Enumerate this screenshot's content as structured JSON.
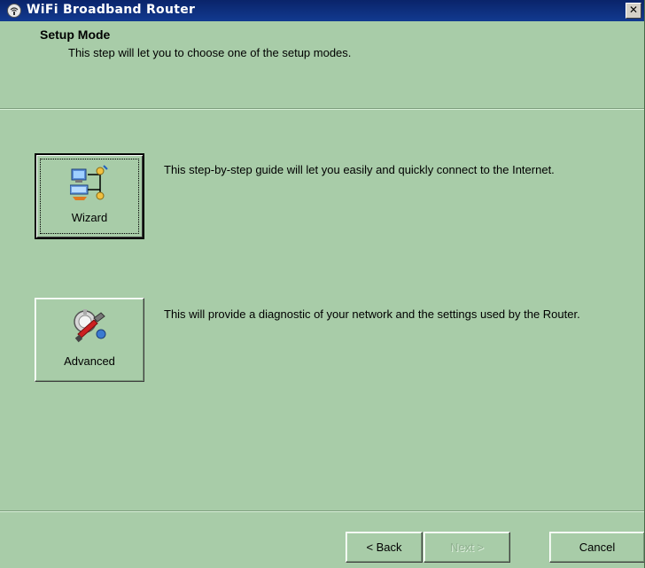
{
  "window": {
    "title": "WiFi Broadband Router",
    "close_label": "✕",
    "icon": "router-app-icon"
  },
  "header": {
    "title": "Setup Mode",
    "subtitle": "This step will let you to choose one of the setup modes."
  },
  "modes": {
    "wizard": {
      "label": "Wizard",
      "icon": "network-wizard-icon",
      "description": "This step-by-step guide will let you easily and quickly connect to the Internet."
    },
    "advanced": {
      "label": "Advanced",
      "icon": "advanced-tools-icon",
      "description": "This will provide a diagnostic of your network and the settings used by the Router."
    }
  },
  "footer": {
    "back_label": "< Back",
    "next_label": "Next >",
    "cancel_label": "Cancel"
  },
  "colors": {
    "background": "#a8cca8",
    "titlebar": "#0a246a"
  }
}
